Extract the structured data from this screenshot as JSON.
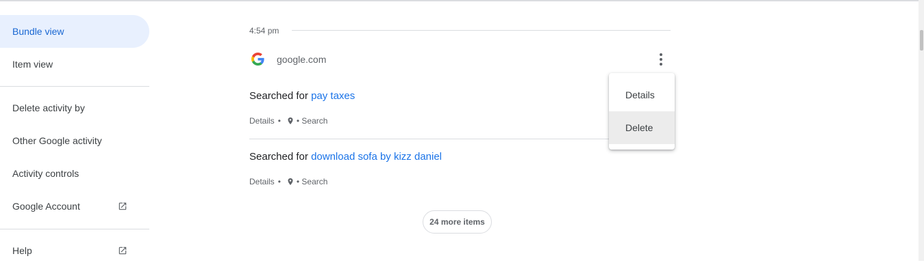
{
  "sidebar": {
    "items": [
      {
        "label": "Bundle view"
      },
      {
        "label": "Item view"
      },
      {
        "label": "Delete activity by"
      },
      {
        "label": "Other Google activity"
      },
      {
        "label": "Activity controls"
      },
      {
        "label": "Google Account",
        "icon": "open-in-new-icon"
      },
      {
        "label": "Help",
        "icon": "open-in-new-icon"
      }
    ]
  },
  "bundle": {
    "time": "4:54 pm",
    "site": "google.com",
    "entries": [
      {
        "prefix": "Searched for ",
        "query": "pay taxes",
        "details": "Details",
        "separator": "•",
        "product": "• Search"
      },
      {
        "prefix": "Searched for ",
        "query": "download sofa by kizz daniel",
        "details": "Details",
        "separator": "•",
        "product": "• Search"
      }
    ],
    "more_button": "24 more items"
  },
  "menu": {
    "items": [
      {
        "label": "Details"
      },
      {
        "label": "Delete"
      }
    ]
  },
  "colors": {
    "accent": "#1a73e8",
    "active_bg": "#e8f0fe",
    "active_text": "#1967d2"
  }
}
